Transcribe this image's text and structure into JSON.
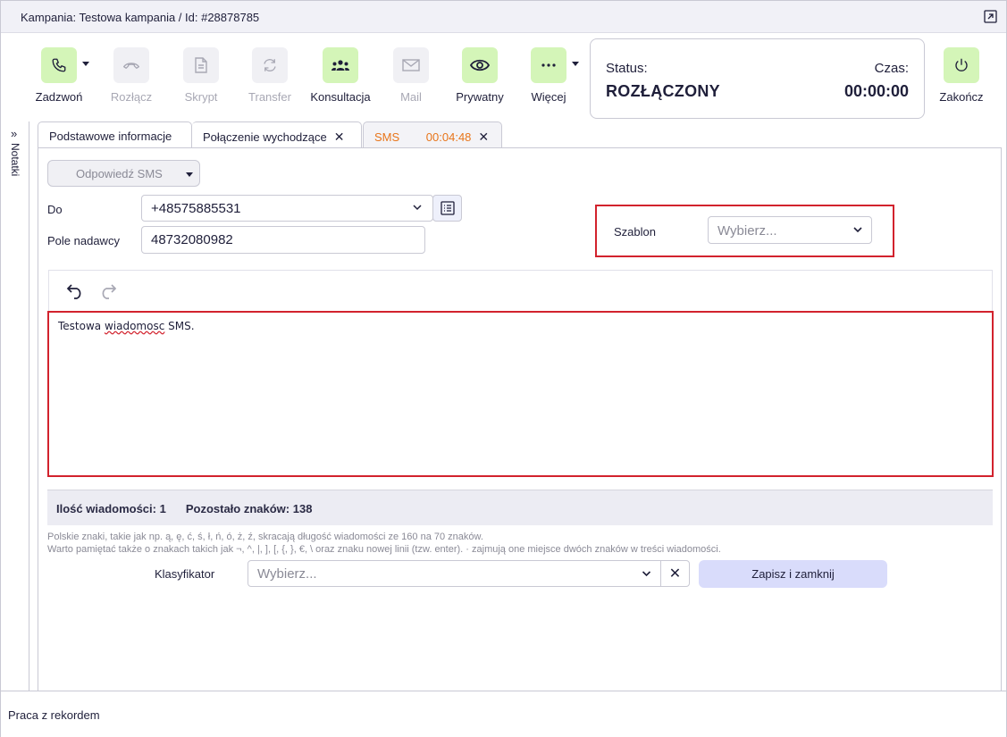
{
  "window": {
    "title": "Kampania: Testowa kampania / Id: #28878785"
  },
  "toolbar": {
    "buttons": [
      {
        "label": "Zadzwoń",
        "icon": "phone-icon",
        "enabled": true
      },
      {
        "label": "Rozłącz",
        "icon": "hangup-icon",
        "enabled": false
      },
      {
        "label": "Skrypt",
        "icon": "document-icon",
        "enabled": false
      },
      {
        "label": "Transfer",
        "icon": "refresh-icon",
        "enabled": false
      },
      {
        "label": "Konsultacja",
        "icon": "group-icon",
        "enabled": true
      },
      {
        "label": "Mail",
        "icon": "mail-icon",
        "enabled": false
      },
      {
        "label": "Prywatny",
        "icon": "eye-icon",
        "enabled": true
      },
      {
        "label": "Więcej",
        "icon": "more-icon",
        "enabled": true
      },
      {
        "label": "Zakończ",
        "icon": "power-icon",
        "enabled": true
      }
    ],
    "status_label": "Status:",
    "status_value": "ROZŁĄCZONY",
    "time_label": "Czas:",
    "time_value": "00:00:00"
  },
  "side_panel": {
    "label": "Notatki"
  },
  "tabs": [
    {
      "label": "Podstawowe informacje"
    },
    {
      "label": "Połączenie wychodzące"
    },
    {
      "label": "SMS",
      "timer": "00:04:48"
    }
  ],
  "sms_form": {
    "reply_button": "Odpowiedź SMS",
    "to_label": "Do",
    "to_value": "+48575885531",
    "sender_label": "Pole nadawcy",
    "sender_value": "48732080982",
    "template_label": "Szablon",
    "template_placeholder": "Wybierz...",
    "message_word1": "Testowa",
    "message_word2": "wiadomosc",
    "message_word3": "SMS.",
    "message_count": "Ilość wiadomości: 1",
    "remaining_chars": "Pozostało znaków: 138",
    "note_line1": "Polskie znaki, takie jak np. ą, ę, ć, ś, ł, ń, ó, ż, ź, skracają długość wiadomości ze 160 na 70 znaków.",
    "note_line2": "Warto pamiętać także o znakach takich jak ¬, ^, |, ], [, {, }, €, \\ oraz znaku nowej linii (tzw. enter). · zajmują one miejsce dwóch znaków w treści wiadomości.",
    "classifier_label": "Klasyfikator",
    "classifier_placeholder": "Wybierz...",
    "save_button": "Zapisz i zamknij"
  },
  "footer": {
    "text": "Praca z rekordem"
  },
  "colors": {
    "accent_green": "#d4f5b8",
    "highlight_red": "#d2222d",
    "sms_tab_orange": "#e8751a",
    "save_button_bg": "#d9dcfb"
  }
}
